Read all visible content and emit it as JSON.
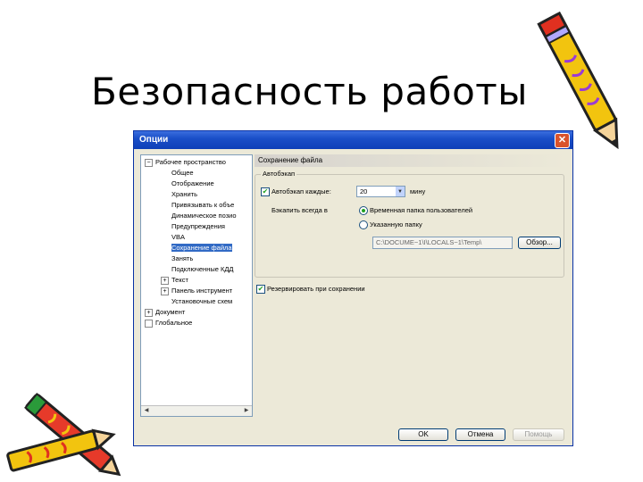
{
  "slide": {
    "title": "Безопасность работы"
  },
  "dialog": {
    "title": "Опции",
    "close_glyph": "✕",
    "tree": [
      {
        "label": "Рабочее пространство",
        "expander": "−"
      },
      {
        "label": "Общее",
        "expander": ""
      },
      {
        "label": "Отображение",
        "expander": ""
      },
      {
        "label": "Хранить",
        "expander": ""
      },
      {
        "label": "Привязывать к объе",
        "expander": ""
      },
      {
        "label": "Динамическое позио",
        "expander": ""
      },
      {
        "label": "Предупреждения",
        "expander": ""
      },
      {
        "label": "VBA",
        "expander": ""
      },
      {
        "label": "Сохранение файла",
        "expander": ""
      },
      {
        "label": "Занять",
        "expander": ""
      },
      {
        "label": "Подключенные КДД",
        "expander": ""
      },
      {
        "label": "Текст",
        "expander": "+"
      },
      {
        "label": "Панель инструмент",
        "expander": "+"
      },
      {
        "label": "Установочные схем",
        "expander": ""
      },
      {
        "label": "Документ",
        "expander": "+"
      },
      {
        "label": "Глобальное",
        "expander": ""
      }
    ],
    "section_title": "Сохранение файла",
    "autobackup": {
      "group_label": "Автобэкап",
      "checkbox_label": "Автобэкап каждые:",
      "interval_value": "20",
      "unit": "мину",
      "save_to_label": "Бэкапить всегда в",
      "option_temp": "Временная папка пользователей",
      "option_custom": "Указанную папку",
      "path_value": "C:\\DOCUME~1\\I\\LOCALS~1\\Temp\\",
      "browse_label": "Обзор..."
    },
    "backup_on_save_label": "Резервировать при сохранении",
    "buttons": {
      "ok": "OK",
      "cancel": "Отмена",
      "help": "Помощь"
    }
  },
  "colors": {
    "titlebar": "#1a4fc8",
    "dialog_bg": "#ece9d8",
    "selection": "#316ac5",
    "check_green": "#21a121"
  }
}
